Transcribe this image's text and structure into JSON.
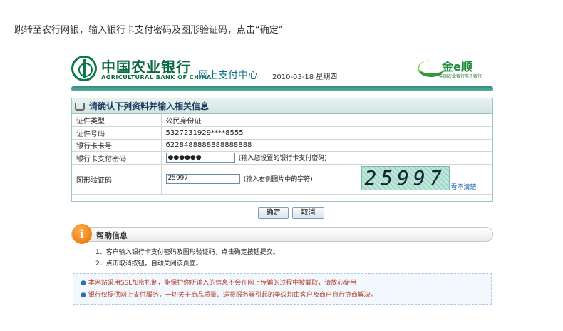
{
  "instruction": "跳转至农行网银，输入银行卡支付密码及图形验证码，点击“确定”",
  "header": {
    "bank_name_cn": "中国农业银行",
    "bank_name_en": "AGRICULTURAL BANK OF CHINA",
    "center_title": "网上支付中心",
    "date": "2010-03-18 星期四",
    "brand_name": "金e顺",
    "brand_sub": "中国农业银行电子银行"
  },
  "form": {
    "title": "请确认下列资料并输入相关信息",
    "rows": [
      {
        "label": "证件类型",
        "value": "公民身份证"
      },
      {
        "label": "证件号码",
        "value": "5327231929****8555"
      },
      {
        "label": "银行卡卡号",
        "value": "6228488888888888888"
      }
    ],
    "password": {
      "label": "银行卡支付密码",
      "value": "●●●●●●",
      "hint": "(输入您设置的银行卡支付密码)"
    },
    "captcha": {
      "label": "图形验证码",
      "value": "25997",
      "hint": "(输入右侧图片中的字符)",
      "image_text": "25997",
      "unclear_link": "看不清楚"
    },
    "confirm_label": "确定",
    "cancel_label": "取消"
  },
  "help": {
    "title": "帮助信息",
    "items": [
      "1．客户输入银行卡支付密码及图形验证码，点击确定按钮提交。",
      "2．点击取消按钮，自动关闭该页面。"
    ]
  },
  "notice": [
    "本网站采用SSL加密机制，能保护你所输入的信息不会在网上传输的过程中被截取，请放心使用！",
    "银行仅提供网上支付服务，一切关于商品质量、送货服务等引起的争议均由客户及商户自行协商解决。"
  ],
  "colors": {
    "brand_green": "#0b6b40",
    "accent_teal": "#2f8d80",
    "notice_red": "#b0402a"
  }
}
